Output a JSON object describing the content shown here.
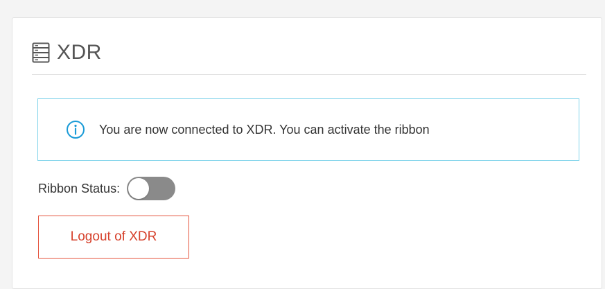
{
  "panel": {
    "title": "XDR",
    "icon": "server-icon"
  },
  "info": {
    "icon": "info-icon",
    "message": "You are now connected to XDR. You can activate the ribbon",
    "border_color": "#7fd3ea",
    "icon_color": "#1a9bd7"
  },
  "ribbon": {
    "label": "Ribbon Status:",
    "enabled": false
  },
  "logout": {
    "label": "Logout of XDR",
    "color": "#d6402b"
  }
}
